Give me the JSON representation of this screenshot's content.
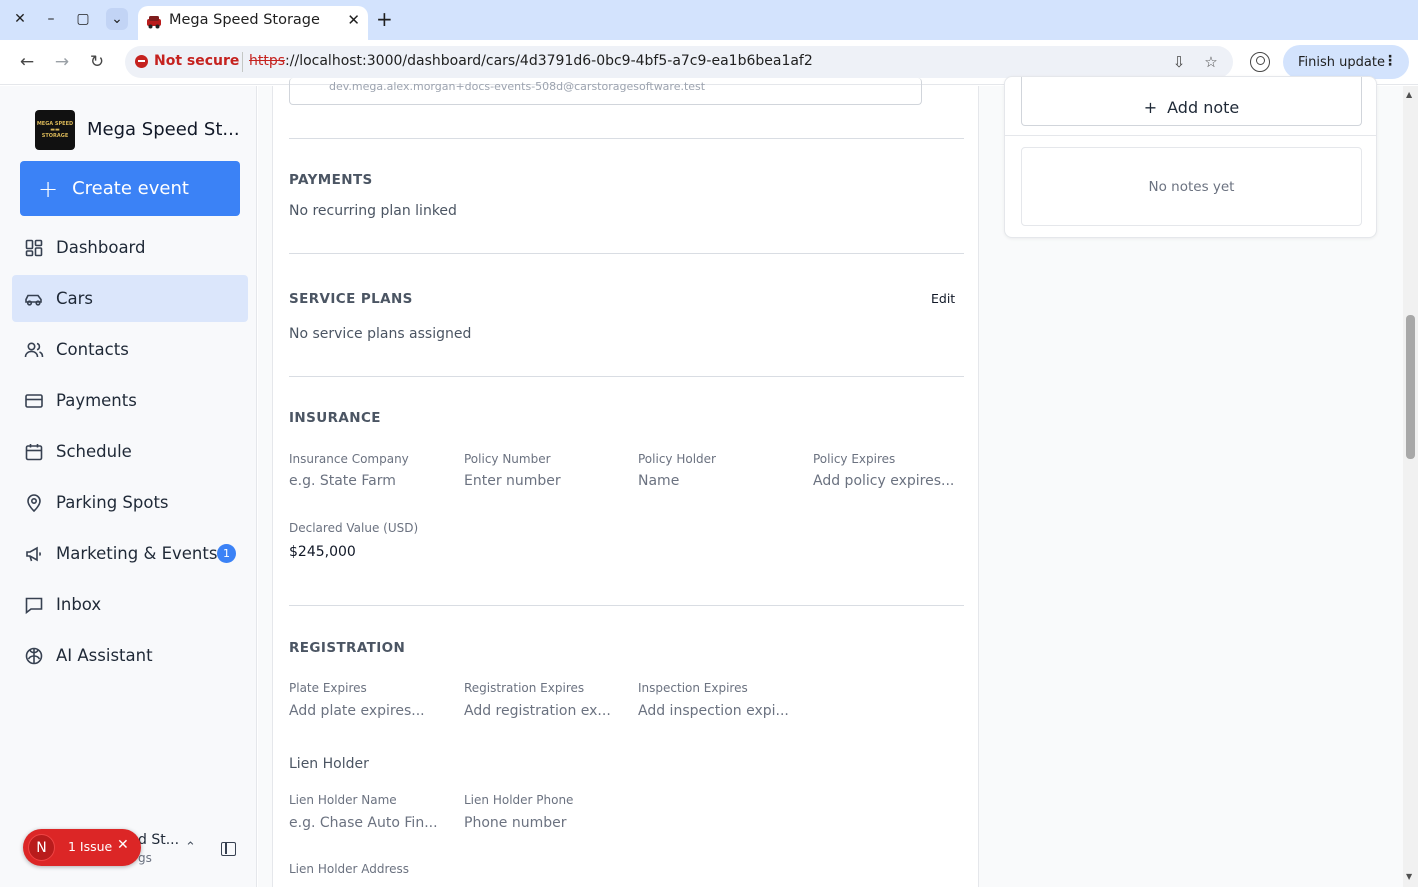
{
  "browser": {
    "tab_title": "Mega Speed Storage",
    "security_label": "Not secure",
    "url_scheme": "https",
    "url_rest": "://localhost:3000/dashboard/cars/4d3791d6-0bc9-4bf5-a7c9-ea1b6bea1af2",
    "finish_update_label": "Finish update"
  },
  "sidebar": {
    "brand_name": "Mega Speed St...",
    "logo_text": "MEGA SPEED STORAGE",
    "create_label": "Create event",
    "items": [
      {
        "label": "Dashboard",
        "icon": "dashboard-icon"
      },
      {
        "label": "Cars",
        "icon": "car-icon",
        "active": true
      },
      {
        "label": "Contacts",
        "icon": "contacts-icon"
      },
      {
        "label": "Payments",
        "icon": "credit-card-icon"
      },
      {
        "label": "Schedule",
        "icon": "calendar-icon"
      },
      {
        "label": "Parking Spots",
        "icon": "map-pin-icon"
      },
      {
        "label": "Marketing & Events",
        "icon": "megaphone-icon",
        "badge": "1"
      },
      {
        "label": "Inbox",
        "icon": "message-icon"
      },
      {
        "label": "AI Assistant",
        "icon": "brain-icon"
      }
    ],
    "footer_name": "d St...",
    "footer_sub": "gs",
    "issue_letter": "N",
    "issue_label": "1 Issue"
  },
  "main": {
    "email_partial": "dev.mega.alex.morgan+docs-events-508d@carstoragesoftware.test",
    "payments": {
      "title": "PAYMENTS",
      "text": "No recurring plan linked"
    },
    "service_plans": {
      "title": "SERVICE PLANS",
      "edit": "Edit",
      "text": "No service plans assigned"
    },
    "insurance": {
      "title": "INSURANCE",
      "company_label": "Insurance Company",
      "company_placeholder": "e.g. State Farm",
      "policy_number_label": "Policy Number",
      "policy_number_placeholder": "Enter number",
      "policy_holder_label": "Policy Holder",
      "policy_holder_placeholder": "Name",
      "policy_expires_label": "Policy Expires",
      "policy_expires_placeholder": "Add policy expires...",
      "declared_label": "Declared Value (USD)",
      "declared_value": "$245,000"
    },
    "registration": {
      "title": "REGISTRATION",
      "plate_label": "Plate Expires",
      "plate_placeholder": "Add plate expires...",
      "reg_label": "Registration Expires",
      "reg_placeholder": "Add registration ex...",
      "insp_label": "Inspection Expires",
      "insp_placeholder": "Add inspection expi...",
      "lien_head": "Lien Holder",
      "lien_name_label": "Lien Holder Name",
      "lien_name_placeholder": "e.g. Chase Auto Fin...",
      "lien_phone_label": "Lien Holder Phone",
      "lien_phone_placeholder": "Phone number",
      "lien_address_label": "Lien Holder Address"
    },
    "notes": {
      "add_label": "Add note",
      "empty": "No notes yet"
    }
  }
}
